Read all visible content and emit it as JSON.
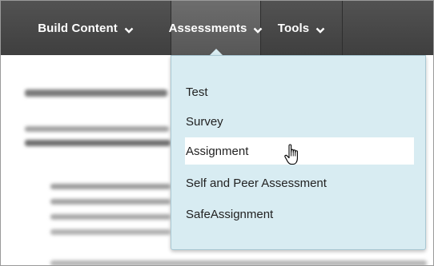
{
  "toolbar": {
    "build_content": "Build Content",
    "assessments": "Assessments",
    "tools": "Tools"
  },
  "icons": {
    "caret": "chevron-down-icon",
    "pointer": "hand-pointer-cursor-icon"
  },
  "assessments_menu": {
    "items": [
      {
        "label": "Test"
      },
      {
        "label": "Survey"
      },
      {
        "label": "Assignment",
        "state": "hovered"
      },
      {
        "label": "Self and Peer Assessment"
      },
      {
        "label": "SafeAssignment"
      }
    ]
  },
  "colors": {
    "toolbar_bg": "#474747",
    "active_tab_bg": "#626262",
    "menu_bg": "#d8ecf2",
    "menu_hover_bg": "#ffffff",
    "menu_text": "#222222"
  }
}
